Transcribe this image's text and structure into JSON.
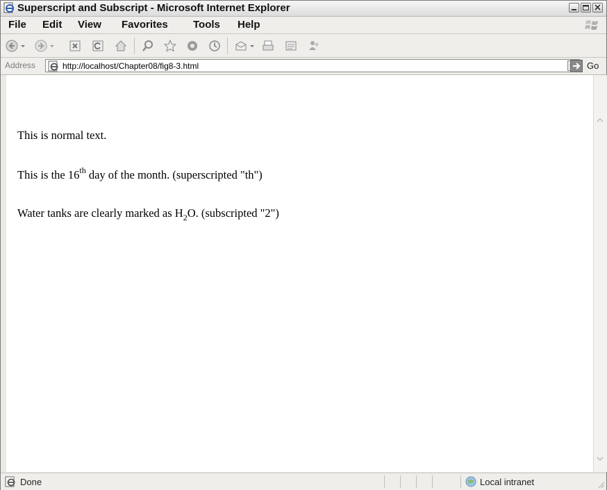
{
  "window": {
    "title": "Superscript and Subscript - Microsoft Internet Explorer"
  },
  "menu": {
    "items": [
      "File",
      "Edit",
      "View",
      "Favorites",
      "Tools",
      "Help"
    ]
  },
  "toolbar": {
    "buttons": [
      "back-icon",
      "back-dropdown-icon",
      "forward-icon",
      "forward-dropdown-icon",
      "stop-icon",
      "refresh-icon",
      "home-icon",
      "search-icon",
      "favorites-star-icon",
      "media-icon",
      "history-icon",
      "mail-icon",
      "mail-dropdown-icon",
      "print-icon",
      "edit-icon",
      "messenger-icon"
    ]
  },
  "address": {
    "label": "Address",
    "url": "http://localhost/Chapter08/fig8-3.html",
    "go_label": "Go"
  },
  "content": {
    "line1": "This is normal text.",
    "line2_before": "This is the 16",
    "line2_sup": "th",
    "line2_after": " day of the month. (superscripted \"th\")",
    "line3_before": "Water tanks are clearly marked as H",
    "line3_sub": "2",
    "line3_after": "O. (subscripted \"2\")"
  },
  "status": {
    "text": "Done",
    "zone": "Local intranet"
  }
}
